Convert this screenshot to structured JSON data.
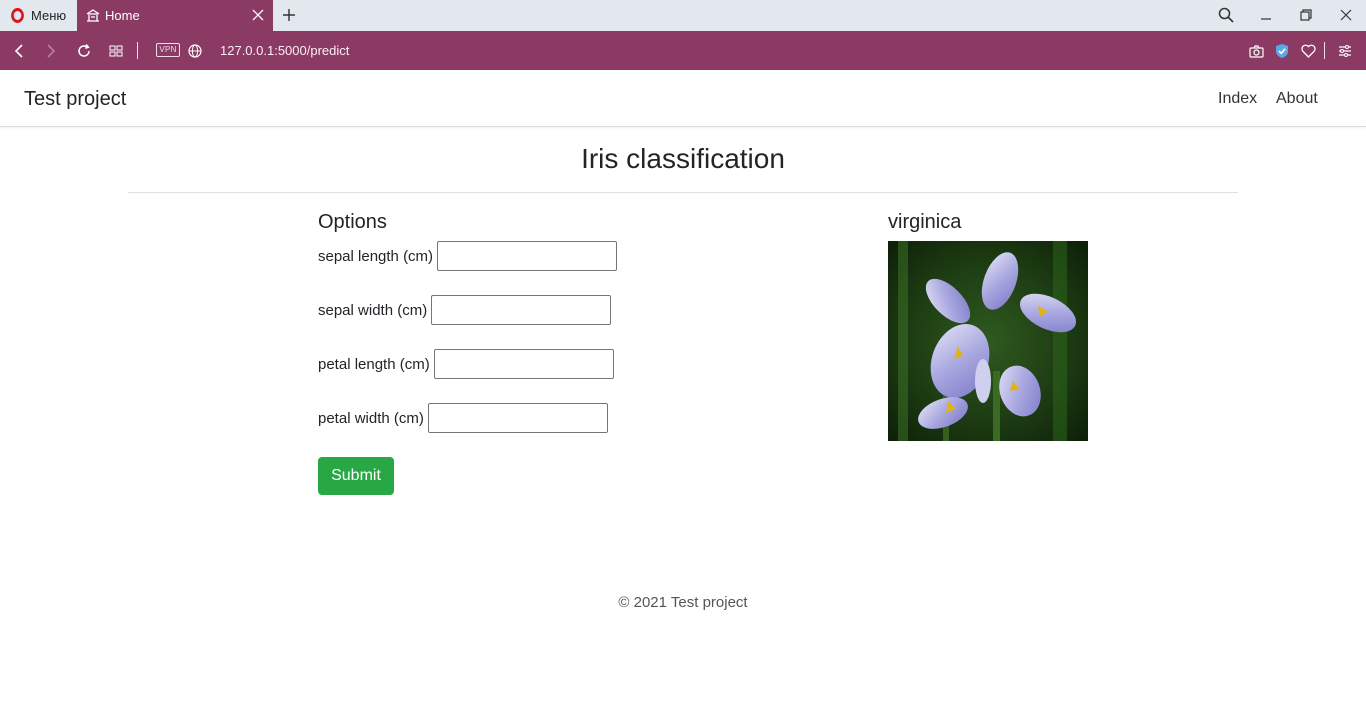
{
  "browser": {
    "menu_label": "Меню",
    "tab_title": "Home",
    "url": "127.0.0.1:5000/predict",
    "vpn_label": "VPN"
  },
  "navbar": {
    "brand": "Test project",
    "links": [
      "Index",
      "About"
    ]
  },
  "main": {
    "title": "Iris classification",
    "form": {
      "heading": "Options",
      "fields": [
        {
          "label": "sepal length (cm)",
          "value": ""
        },
        {
          "label": "sepal width (cm)",
          "value": ""
        },
        {
          "label": "petal length (cm)",
          "value": ""
        },
        {
          "label": "petal width (cm)",
          "value": ""
        }
      ],
      "submit_label": "Submit"
    },
    "result": {
      "prediction": "virginica",
      "image": "iris-flower-photo"
    }
  },
  "footer": {
    "text": "© 2021 Test project"
  },
  "colors": {
    "browser_accent": "#8b3a64",
    "submit_button": "#28a745"
  }
}
